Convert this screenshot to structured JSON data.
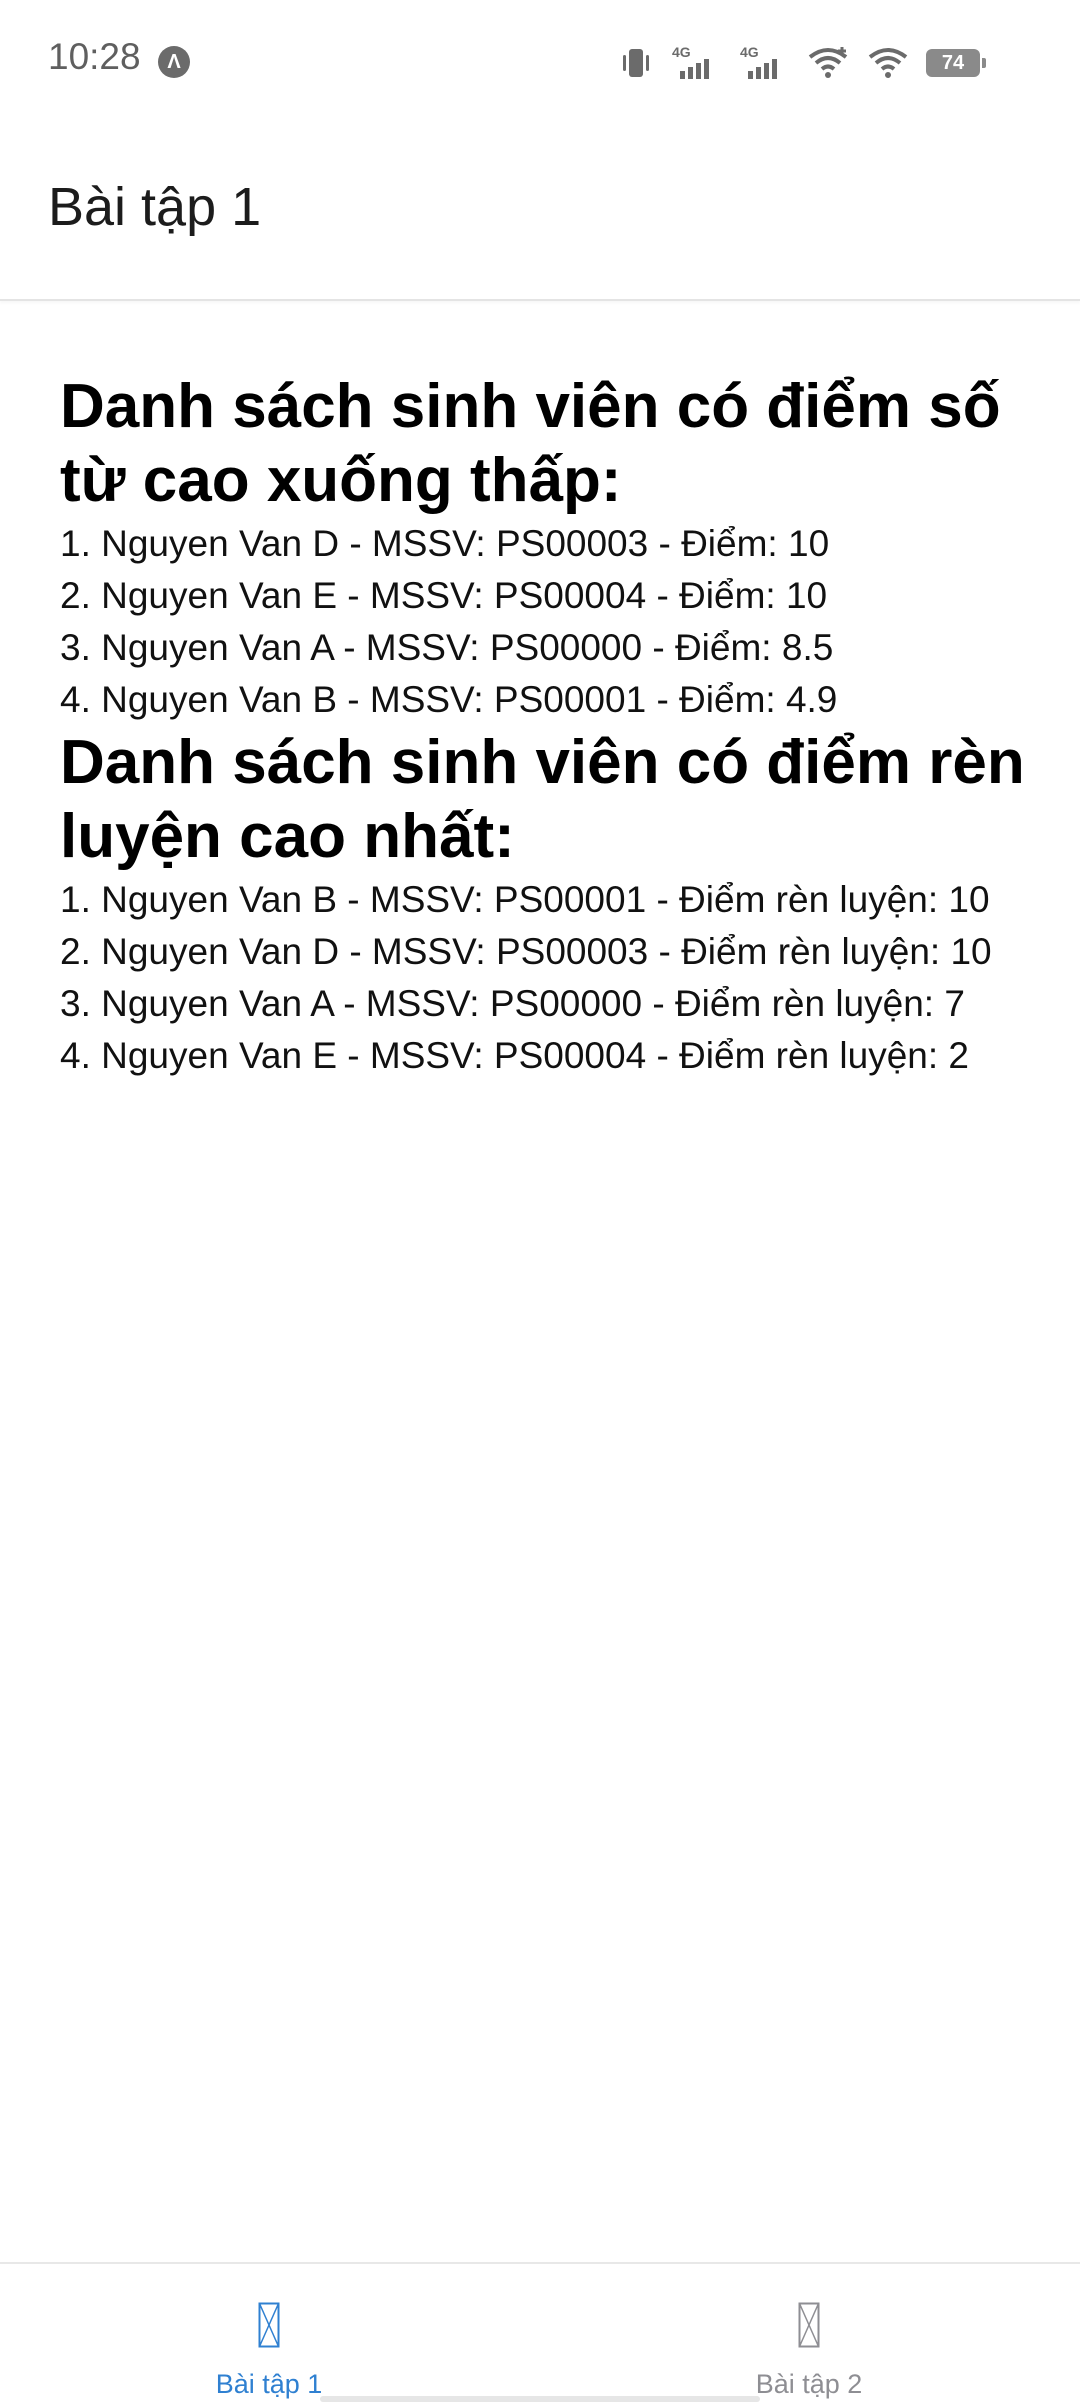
{
  "status_bar": {
    "time": "10:28",
    "app_icon_glyph": "Λ",
    "battery": "74",
    "network_1": "4G",
    "network_2": "4G"
  },
  "header": {
    "title": "Bài tập 1"
  },
  "sections": [
    {
      "heading": "Danh sách sinh viên có điểm số từ cao xuống thấp:",
      "items": [
        "1. Nguyen Van D - MSSV: PS00003 - Điểm: 10",
        "2. Nguyen Van E - MSSV: PS00004 - Điểm: 10",
        "3. Nguyen Van A - MSSV: PS00000 - Điểm: 8.5",
        "4. Nguyen Van B - MSSV: PS00001 - Điểm: 4.9"
      ]
    },
    {
      "heading": "Danh sách sinh viên có điểm rèn luyện cao nhất:",
      "items": [
        "1. Nguyen Van B - MSSV: PS00001 - Điểm rèn luyện: 10",
        "2. Nguyen Van D - MSSV: PS00003 - Điểm rèn luyện: 10",
        "3. Nguyen Van A - MSSV: PS00000 - Điểm rèn luyện: 7",
        "4. Nguyen Van E - MSSV: PS00004 - Điểm rèn luyện: 2"
      ]
    }
  ],
  "tabs": [
    {
      "label": "Bài tập 1",
      "active": true,
      "icon": "missing-glyph-icon"
    },
    {
      "label": "Bài tập 2",
      "active": false,
      "icon": "missing-glyph-icon"
    }
  ],
  "colors": {
    "active_tab": "#2f80d1",
    "inactive_tab": "#8e8e93",
    "status_text": "#5f5f5f"
  }
}
